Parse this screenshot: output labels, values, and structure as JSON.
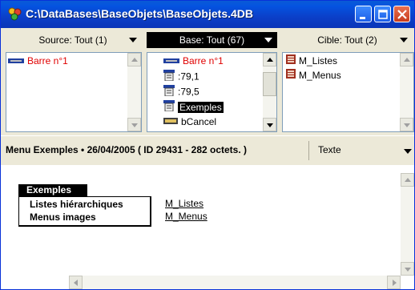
{
  "window": {
    "title": "C:\\DataBases\\BaseObjets\\BaseObjets.4DB",
    "accent": "#0453e0"
  },
  "columns": {
    "source": {
      "header": "Source: Tout (1)",
      "items": [
        {
          "label": "Barre n°1",
          "icon": "menubar-icon",
          "color": "#e00000"
        }
      ]
    },
    "base": {
      "header": "Base: Tout (67)",
      "items": [
        {
          "label": "Barre n°1",
          "icon": "menubar-icon",
          "color": "#e00000"
        },
        {
          "label": ":79,1",
          "icon": "menu-icon"
        },
        {
          "label": ":79,5",
          "icon": "menu-icon"
        },
        {
          "label": "Exemples",
          "icon": "menu-icon",
          "selected": true
        },
        {
          "label": "bCancel",
          "icon": "button-icon"
        }
      ]
    },
    "cible": {
      "header": "Cible: Tout (2)",
      "items": [
        {
          "label": "M_Listes",
          "icon": "list-object-icon"
        },
        {
          "label": "M_Menus",
          "icon": "list-object-icon"
        }
      ]
    }
  },
  "info": {
    "description": "Menu Exemples  •  26/04/2005 ( ID 29431 - 282 octets. )",
    "format": "Texte"
  },
  "preview": {
    "menu_title": "Exemples",
    "items": [
      {
        "label": "Listes hiérarchiques",
        "link": "M_Listes"
      },
      {
        "label": "Menus images",
        "link": "M_Menus"
      }
    ]
  }
}
